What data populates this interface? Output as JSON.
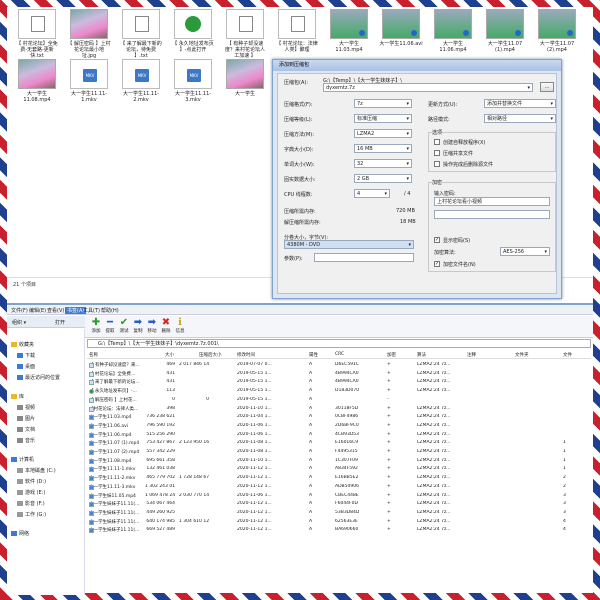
{
  "top_explorer": {
    "tiles_row1": [
      {
        "name": "【 村花论坛】全免费-无套路-更新快.txt",
        "kind": "txt"
      },
      {
        "name": "【 解压密码 】上村花论坛最小地址.jpg",
        "kind": "photo"
      },
      {
        "name": "【 来了解最下新的论坛，待免费 】.txt",
        "kind": "txt"
      },
      {
        "name": "【 永久地址发布页 】-点此打开",
        "kind": "ie"
      },
      {
        "name": "【 有种子却没速度？来村花论坛人工加速 】",
        "kind": "txt"
      },
      {
        "name": "【 村花论坛：法律人类】聚理",
        "kind": "txt"
      },
      {
        "name": "大一学生11.03.mp4",
        "kind": "video"
      },
      {
        "name": "大一学生11.06.avi",
        "kind": "video"
      },
      {
        "name": "大一学生11.06.mp4",
        "kind": "video"
      },
      {
        "name": "大一学生11.07 (1).mp4",
        "kind": "video"
      },
      {
        "name": "大一学生11.07 (2).mp4",
        "kind": "video"
      }
    ],
    "tiles_row2": [
      {
        "name": "大一学生11.08.mp4",
        "kind": "photo"
      },
      {
        "name": "大一学生11.11-1.mkv",
        "kind": "mkv"
      },
      {
        "name": "大一学生11.11-2.mkv",
        "kind": "mkv"
      },
      {
        "name": "大一学生11.11-3.mkv",
        "kind": "mkv"
      },
      {
        "name": "大一学生",
        "kind": "photo"
      }
    ],
    "mkv_label": "MKV",
    "status": "21 个项目"
  },
  "dialog": {
    "title": "添加到压缩包",
    "archive_label": "压缩包(A):",
    "archive_path": "G:\\【Temp】\\【大一学生妹妹子】\\",
    "archive_name": "dyxemtz.7z",
    "browse_label": "...",
    "format_label": "压缩格式(F):",
    "format_value": "7z",
    "level_label": "压缩等级(L):",
    "level_value": "标准压缩",
    "method_label": "压缩方法(M):",
    "method_value": "LZMA2",
    "dict_label": "字典大小(D):",
    "dict_value": "16 MB",
    "word_label": "单词大小(W):",
    "word_value": "32",
    "solid_label": "固实数据大小:",
    "solid_value": "2 GB",
    "threads_label": "CPU 线程数:",
    "threads_value": "4",
    "threads_total": "/ 4",
    "mem_comp_label": "压缩所需内存:",
    "mem_comp_value": "720 MB",
    "mem_decomp_label": "解压缩所需内存:",
    "mem_decomp_value": "18 MB",
    "split_label": "分卷大小，字节(V):",
    "split_value": "4380M - DVD",
    "params_label": "参数(P):",
    "update_label": "更新方式(U):",
    "update_value": "添加并替换文件",
    "pathmode_label": "路径模式:",
    "pathmode_value": "相对路径",
    "options_label": "选项",
    "opt_sfx": "创建自释放程序(X)",
    "opt_shared": "压缩共享文件",
    "opt_delete": "操作完成后删除源文件",
    "encrypt_label": "加密",
    "password_label": "输入密码:",
    "password_value": "上村花论坛看小视频",
    "show_password": "显示密码(S)",
    "enc_method_label": "加密算法:",
    "enc_method_value": "AES-256",
    "encrypt_names": "加密文件名(N)"
  },
  "zip_window": {
    "menus": [
      "文件(F)",
      "编辑(E)",
      "查看(V)",
      "书签(A)",
      "工具(T)",
      "帮助(H)"
    ],
    "organize": "组织 ▾",
    "open": "打开",
    "tools": [
      {
        "label": "添加",
        "glyph": "✚",
        "color": "#2a9a2a"
      },
      {
        "label": "提取",
        "glyph": "━",
        "color": "#2a5bd0"
      },
      {
        "label": "测试",
        "glyph": "✔",
        "color": "#2a9a2a"
      },
      {
        "label": "复制",
        "glyph": "➡",
        "color": "#2a5bd0"
      },
      {
        "label": "移动",
        "glyph": "➡",
        "color": "#2a5bd0"
      },
      {
        "label": "删除",
        "glyph": "✖",
        "color": "#d02a2a"
      },
      {
        "label": "信息",
        "glyph": "ℹ",
        "color": "#c8a020"
      }
    ],
    "address": "G:\\【Temp】\\【大一学生妹妹子】\\dyxemtz.7z.001\\",
    "nav": [
      {
        "label": "收藏夹",
        "indent": 0
      },
      {
        "label": "下载",
        "indent": 1
      },
      {
        "label": "桌面",
        "indent": 1
      },
      {
        "label": "最近访问的位置",
        "indent": 1
      },
      {
        "label": "库",
        "indent": 0
      },
      {
        "label": "视频",
        "indent": 1
      },
      {
        "label": "图片",
        "indent": 1
      },
      {
        "label": "文档",
        "indent": 1
      },
      {
        "label": "音乐",
        "indent": 1
      },
      {
        "label": "计算机",
        "indent": 0
      },
      {
        "label": "本地磁盘 (C:)",
        "indent": 1
      },
      {
        "label": "软件 (D:)",
        "indent": 1
      },
      {
        "label": "游戏 (E:)",
        "indent": 1
      },
      {
        "label": "影音 (F:)",
        "indent": 1
      },
      {
        "label": "工作 (G:)",
        "indent": 1
      },
      {
        "label": "网络",
        "indent": 0
      }
    ],
    "columns": [
      "名称",
      "大小",
      "压缩后大小",
      "修改时间",
      "属性",
      "CRC",
      "加密",
      "算法",
      "注释",
      "文件夹",
      "文件"
    ],
    "rows": [
      [
        "【 有种子却没速度？来...",
        "469",
        "2 017 846 144",
        "2019-07-07 0...",
        "A",
        "D6EC591C",
        "+",
        "LZMA2:24 7z...",
        "",
        "",
        ""
      ],
      [
        "【 村花论坛】全免费...",
        "431",
        "",
        "2019-05-15 1...",
        "A",
        "4B994CA0",
        "+",
        "LZMA2:24 7z...",
        "",
        "",
        ""
      ],
      [
        "【 来了解最下新的论坛...",
        "431",
        "",
        "2019-05-15 1...",
        "A",
        "4B994CA0",
        "+",
        "LZMA2:24 7z...",
        "",
        "",
        ""
      ],
      [
        "【 永久地址发布页】-...",
        "113",
        "",
        "2019-05-15 1...",
        "A",
        "D183D070",
        "+",
        "LZMA2:24 7z...",
        "",
        "",
        ""
      ],
      [
        "【 解压密码 】上村花...",
        "0",
        "0",
        "2019-05-15 1...",
        "A",
        "",
        "-",
        "",
        "",
        "",
        ""
      ],
      [
        "【村花论坛：法律人类...",
        "398",
        "",
        "2020-11-10 1...",
        "A",
        "30118F5D",
        "+",
        "LZMA2:24 7z...",
        "",
        "",
        ""
      ],
      [
        "大一学生11.03.mp4",
        "736 238 621",
        "",
        "2020-11-04 1...",
        "A",
        "0CBF4986",
        "+",
        "LZMA2:24 7z...",
        "",
        "",
        ""
      ],
      [
        "大一学生11.06.avi",
        "796 590 192",
        "",
        "2020-11-06 1...",
        "A",
        "2D6BF9C0",
        "+",
        "LZMA2:24 7z...",
        "",
        "",
        ""
      ],
      [
        "大一学生11.06.mp4",
        "515 256 290",
        "",
        "2020-11-06 1...",
        "A",
        "4CB93D53",
        "+",
        "LZMA2:24 7z...",
        "",
        "",
        ""
      ],
      [
        "大一学生11.07 (1).mp4",
        "753 427 867",
        "2 123 950 160",
        "2020-11-08 1...",
        "A",
        "E16016C9",
        "+",
        "LZMA2:24 7z...",
        "",
        "",
        "1"
      ],
      [
        "大一学生11.07 (2).mp4",
        "557 342 229",
        "",
        "2020-11-08 1...",
        "A",
        "F4495315",
        "+",
        "LZMA2:24 7z...",
        "",
        "",
        "1"
      ],
      [
        "大一学生11.08.mp4",
        "695 661 358",
        "",
        "2020-11-10 1...",
        "A",
        "1C307F09",
        "+",
        "LZMA2:24 7z...",
        "",
        "",
        "1"
      ],
      [
        "大一学生11.11-1.mkv",
        "132 461 038",
        "",
        "2020-11-12 1...",
        "A",
        "A834F592",
        "+",
        "LZMA2:24 7z...",
        "",
        "",
        "1"
      ],
      [
        "大一学生11.11-2.mkv",
        "465 779 702",
        "1 728 148 672",
        "2020-11-12 1...",
        "A",
        "E16BB5E2",
        "+",
        "LZMA2:24 7z...",
        "",
        "",
        "2"
      ],
      [
        "大一学生11.11-3.mkv",
        "1 302 243 013",
        "",
        "2020-11-12 1...",
        "A",
        "ADB50906",
        "+",
        "LZMA2:24 7z...",
        "",
        "",
        "2"
      ],
      [
        "大一学生妹11.05.mp4",
        "1 069 478 241",
        "2 030 770 144",
        "2020-11-06 1...",
        "A",
        "CBEC448E",
        "+",
        "LZMA2:24 7z...",
        "",
        "",
        "3"
      ],
      [
        "大一学生妹妹子11.11(...",
        "534 067 464",
        "",
        "2020-11-12 1...",
        "A",
        "F6044F0D",
        "+",
        "LZMA2:24 7z...",
        "",
        "",
        "3"
      ],
      [
        "大一学生妹妹子11.11(...",
        "449 260 925",
        "",
        "2020-11-12 1...",
        "A",
        "53B3D84D",
        "+",
        "LZMA2:24 7z...",
        "",
        "",
        "3"
      ],
      [
        "大一学生妹妹子11.11(...",
        "640 174 985",
        "1 304 610 128",
        "2020-11-12 1...",
        "A",
        "62563E3E",
        "+",
        "LZMA2:24 7z...",
        "",
        "",
        "4"
      ],
      [
        "大一学生妹妹子11.11(...",
        "669 527 489",
        "",
        "2020-11-12 1...",
        "A",
        "BA690660",
        "+",
        "LZMA2:24 7z...",
        "",
        "",
        "4"
      ]
    ]
  }
}
